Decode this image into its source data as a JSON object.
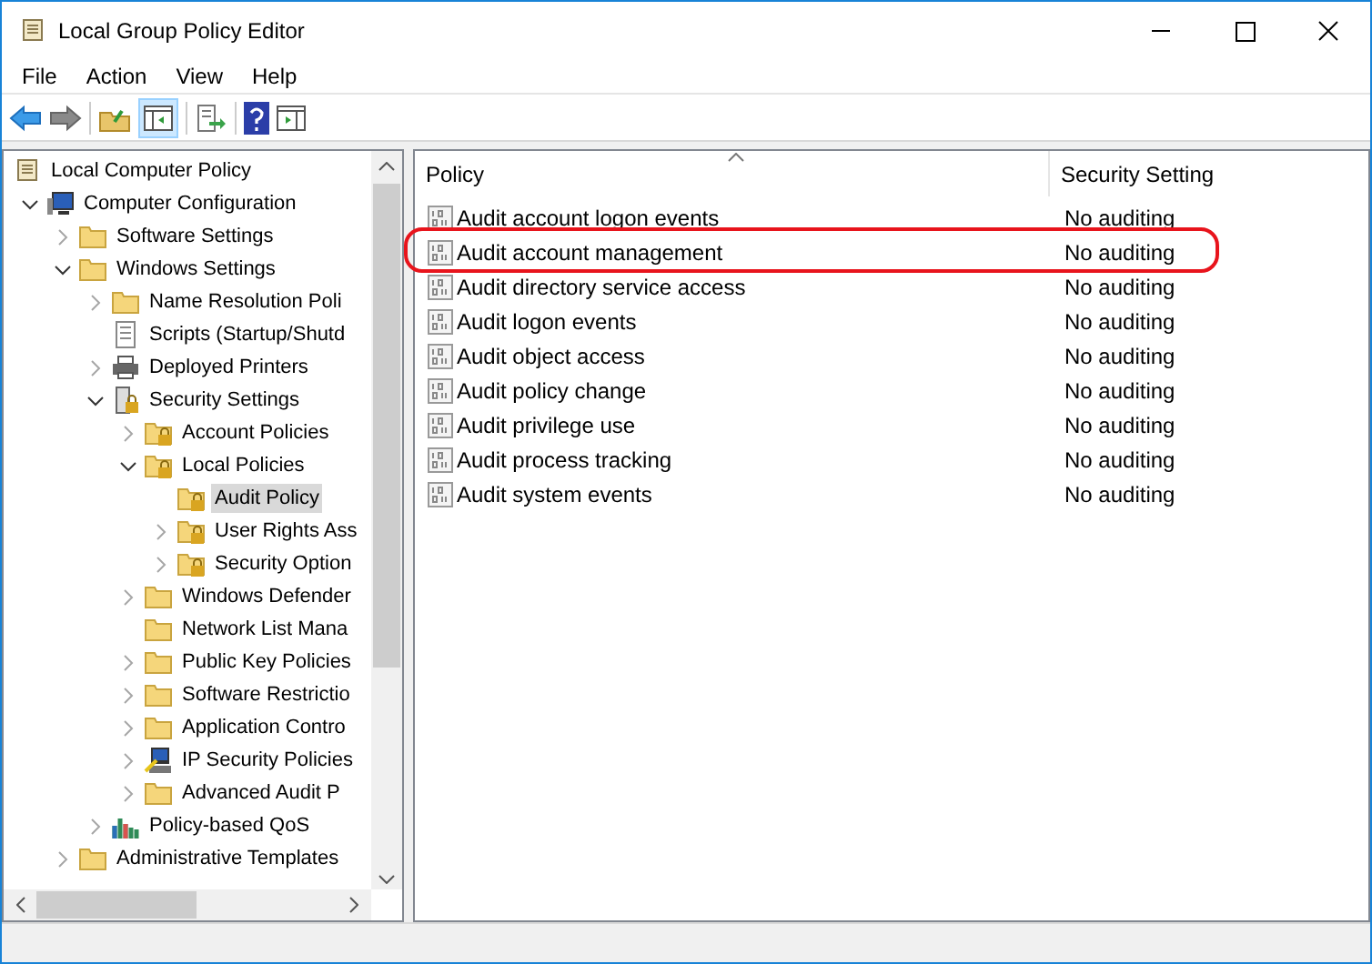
{
  "window": {
    "title": "Local Group Policy Editor"
  },
  "menu": [
    "File",
    "Action",
    "View",
    "Help"
  ],
  "tree": [
    {
      "label": "Local Computer Policy",
      "kind": "scroll",
      "selected": false,
      "children": [
        {
          "label": "Computer Configuration",
          "kind": "computer",
          "expanded": true,
          "selected": false,
          "children": [
            {
              "label": "Software Settings",
              "kind": "folder",
              "expanded": false,
              "selected": false
            },
            {
              "label": "Windows Settings",
              "kind": "folder",
              "expanded": true,
              "selected": false,
              "children": [
                {
                  "label": "Name Resolution Poli",
                  "kind": "folder",
                  "expanded": false,
                  "selected": false
                },
                {
                  "label": "Scripts (Startup/Shutd",
                  "kind": "script",
                  "selected": false
                },
                {
                  "label": "Deployed Printers",
                  "kind": "printer",
                  "expanded": false,
                  "selected": false
                },
                {
                  "label": "Security Settings",
                  "kind": "security",
                  "expanded": true,
                  "selected": false,
                  "children": [
                    {
                      "label": "Account Policies",
                      "kind": "lockfolder",
                      "expanded": false,
                      "selected": false
                    },
                    {
                      "label": "Local Policies",
                      "kind": "lockfolder",
                      "expanded": true,
                      "selected": false,
                      "children": [
                        {
                          "label": "Audit Policy",
                          "kind": "lockfolder",
                          "selected": true
                        },
                        {
                          "label": "User Rights Ass",
                          "kind": "lockfolder",
                          "expanded": false,
                          "selected": false
                        },
                        {
                          "label": "Security Option",
                          "kind": "lockfolder",
                          "expanded": false,
                          "selected": false
                        }
                      ]
                    },
                    {
                      "label": "Windows Defender",
                      "kind": "folder",
                      "expanded": false,
                      "selected": false
                    },
                    {
                      "label": "Network List Mana",
                      "kind": "folder",
                      "selected": false
                    },
                    {
                      "label": "Public Key Policies",
                      "kind": "folder",
                      "expanded": false,
                      "selected": false
                    },
                    {
                      "label": "Software Restrictio",
                      "kind": "folder",
                      "expanded": false,
                      "selected": false
                    },
                    {
                      "label": "Application Contro",
                      "kind": "folder",
                      "expanded": false,
                      "selected": false
                    },
                    {
                      "label": "IP Security Policies",
                      "kind": "network",
                      "expanded": false,
                      "selected": false
                    },
                    {
                      "label": "Advanced Audit P",
                      "kind": "folder",
                      "expanded": false,
                      "selected": false
                    }
                  ]
                },
                {
                  "label": "Policy-based QoS",
                  "kind": "qos",
                  "expanded": false,
                  "selected": false
                }
              ]
            },
            {
              "label": "Administrative Templates",
              "kind": "folder",
              "expanded": false,
              "selected": false
            }
          ]
        }
      ]
    }
  ],
  "table": {
    "columns": [
      "Policy",
      "Security Setting"
    ],
    "rows": [
      {
        "policy": "Audit account logon events",
        "setting": "No auditing",
        "highlighted": false
      },
      {
        "policy": "Audit account management",
        "setting": "No auditing",
        "highlighted": true
      },
      {
        "policy": "Audit directory service access",
        "setting": "No auditing",
        "highlighted": false
      },
      {
        "policy": "Audit logon events",
        "setting": "No auditing",
        "highlighted": false
      },
      {
        "policy": "Audit object access",
        "setting": "No auditing",
        "highlighted": false
      },
      {
        "policy": "Audit policy change",
        "setting": "No auditing",
        "highlighted": false
      },
      {
        "policy": "Audit privilege use",
        "setting": "No auditing",
        "highlighted": false
      },
      {
        "policy": "Audit process tracking",
        "setting": "No auditing",
        "highlighted": false
      },
      {
        "policy": "Audit system events",
        "setting": "No auditing",
        "highlighted": false
      }
    ]
  }
}
